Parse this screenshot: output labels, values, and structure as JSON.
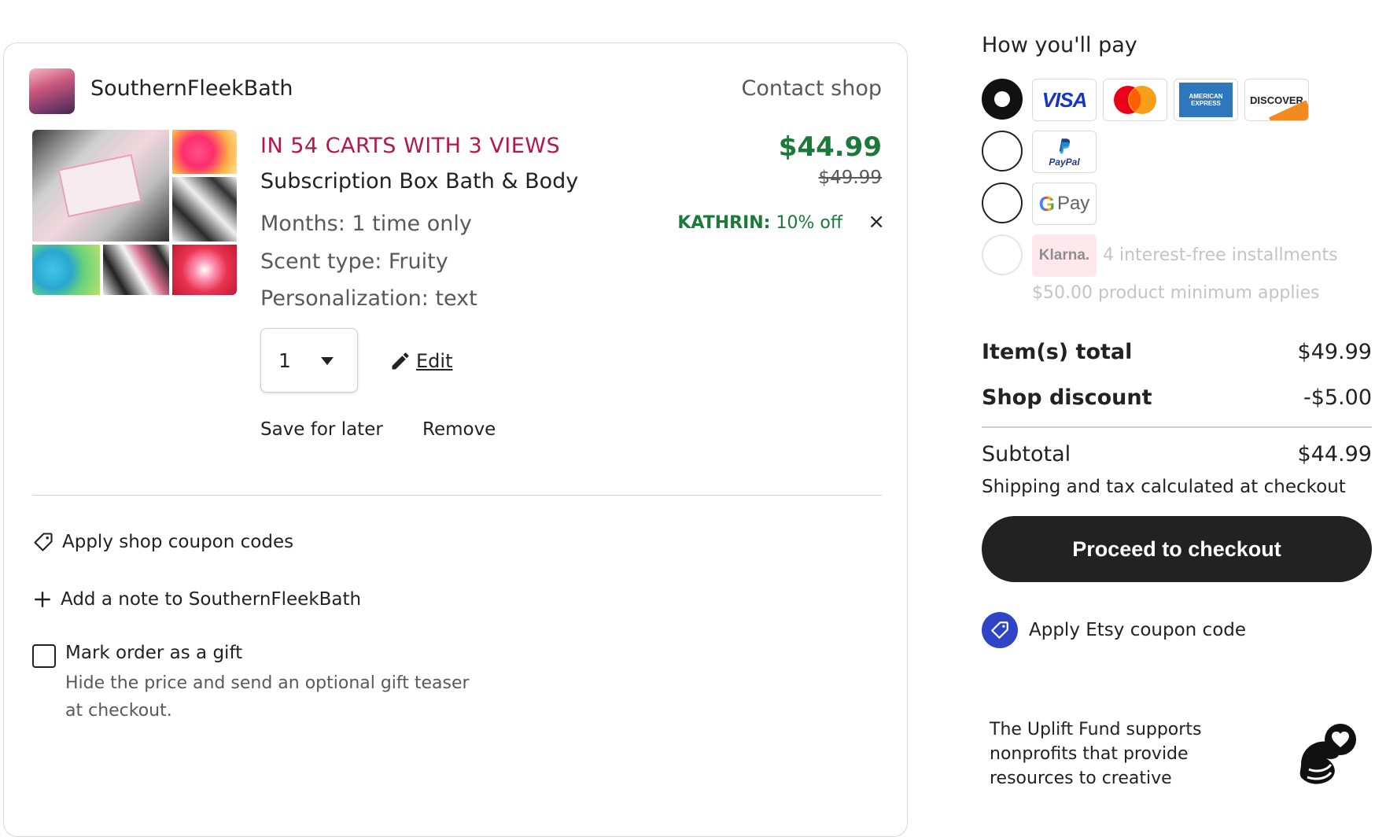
{
  "shop": {
    "name": "SouthernFleekBath",
    "contact_label": "Contact shop"
  },
  "item": {
    "badge": "IN 54 CARTS WITH 3 VIEWS",
    "title": "Subscription Box Bath & Body",
    "options": [
      "Months: 1 time only",
      "Scent type: Fruity",
      "Personalization: text"
    ],
    "price": "$44.99",
    "original_price": "$49.99",
    "discount_code": "KATHRIN:",
    "discount_text": "10% off",
    "discount_close": "×",
    "quantity": "1",
    "edit_label": "Edit",
    "save_for_later": "Save for later",
    "remove": "Remove"
  },
  "card_footer": {
    "apply_coupon": "Apply shop coupon codes",
    "add_note": "Add a note to SouthernFleekBath",
    "gift_label": "Mark order as a gift",
    "gift_desc": "Hide the price and send an optional gift teaser at checkout."
  },
  "payment": {
    "title": "How you'll pay",
    "methods": [
      {
        "name": "cards",
        "selected": true,
        "logos": [
          "VISA",
          "Mastercard",
          "American Express",
          "DISCOVER"
        ]
      },
      {
        "name": "paypal",
        "selected": false,
        "logo_text": "PayPal"
      },
      {
        "name": "googlepay",
        "selected": false,
        "logo_text": "Pay"
      },
      {
        "name": "klarna",
        "selected": false,
        "disabled": true,
        "logo_text": "Klarna.",
        "note": "4 interest-free installments",
        "min_note": "$50.00 product minimum applies"
      }
    ]
  },
  "summary": {
    "items_total_label": "Item(s) total",
    "items_total_value": "$49.99",
    "shop_discount_label": "Shop discount",
    "shop_discount_value": "-$5.00",
    "subtotal_label": "Subtotal",
    "subtotal_value": "$44.99",
    "shipping_note": "Shipping and tax calculated at checkout",
    "checkout_label": "Proceed to checkout",
    "etsy_coupon": "Apply Etsy coupon code"
  },
  "uplift": {
    "text": "The Uplift Fund supports nonprofits that provide resources to creative"
  },
  "colors": {
    "price_green": "#1b7a3a",
    "badge_red": "#b5174b",
    "checkout_bg": "#222222",
    "coupon_blue": "#2f45c5"
  }
}
